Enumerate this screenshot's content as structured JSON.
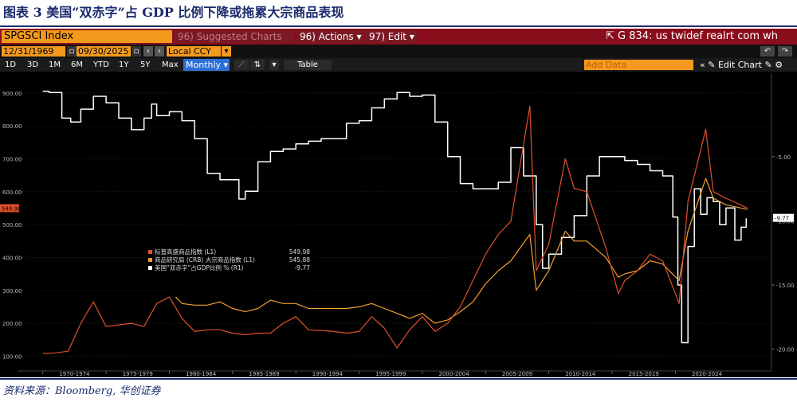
{
  "figure": {
    "title": "图表 3 美国“双赤字”占 GDP 比例下降或拖累大宗商品表现",
    "source": "资料来源：Bloomberg, 华创证券"
  },
  "terminal": {
    "ticker": "SPGSCI Index",
    "suggested": "96) Suggested Charts",
    "actions": "96) Actions",
    "edit": "97) Edit",
    "command": "G 834: us twidef realrt com wh",
    "start_date": "12/31/1969",
    "end_date": "09/30/2025",
    "currency": "Local CCY",
    "ranges": [
      "1D",
      "3D",
      "1M",
      "6M",
      "YTD",
      "1Y",
      "5Y",
      "Max"
    ],
    "frequency": "Monthly",
    "table_label": "Table",
    "add_data_placeholder": "Add Data",
    "edit_chart_label": "Edit Chart",
    "colors": {
      "bar_red": "#8a0d1c",
      "amber": "#f39a1e",
      "bg": "#000000"
    }
  },
  "chart_data": {
    "type": "line",
    "left_axis": {
      "ticks": [
        "100.00",
        "200.00",
        "300.00",
        "400.00",
        "500.00",
        "600.00",
        "700.00",
        "800.00",
        "900.00"
      ],
      "ylim": [
        55,
        960
      ]
    },
    "right_axis": {
      "ticks": [
        "-5.00",
        "-10.00",
        "-15.00",
        "-20.00"
      ],
      "ylim": [
        -21.7,
        1.5
      ]
    },
    "x_ticks": [
      "1970-1974",
      "1975-1979",
      "1980-1984",
      "1985-1989",
      "1990-1994",
      "1995-1999",
      "2000-2004",
      "2005-2009",
      "2010-2014",
      "2015-2019",
      "2020-2024"
    ],
    "xlim": [
      1968.0,
      2027.6
    ],
    "price_tag": "549.98",
    "deficit_tag": "-9.77",
    "legend": [
      {
        "name": "标普高盛商品指数 (L1)",
        "value": "549.98",
        "color": "#e0502b"
      },
      {
        "name": "商品研究局 (CRB) 大宗商品指数 (L1)",
        "value": "545.88",
        "color": "#f0a030"
      },
      {
        "name": "美国“双赤字”占GDP比例 % (R1)",
        "value": "-9.77",
        "color": "#ffffff"
      }
    ],
    "series": [
      {
        "name": "标普高盛商品指数 (L1)",
        "axis": "left",
        "x": [
          1970.0,
          1971.0,
          1972.0,
          1973.0,
          1974.0,
          1975.0,
          1976.0,
          1977.0,
          1978.0,
          1979.0,
          1980.0,
          1981.0,
          1982.0,
          1983.0,
          1984.0,
          1985.0,
          1986.0,
          1987.0,
          1988.0,
          1989.0,
          1990.0,
          1991.0,
          1992.0,
          1993.0,
          1994.0,
          1995.0,
          1996.0,
          1997.0,
          1998.0,
          1999.0,
          2000.0,
          2001.0,
          2002.0,
          2003.0,
          2004.0,
          2005.0,
          2006.0,
          2007.0,
          2008.5,
          2009.0,
          2010.0,
          2011.3,
          2012.0,
          2013.0,
          2014.5,
          2015.5,
          2016.0,
          2017.0,
          2018.0,
          2019.0,
          2020.3,
          2021.0,
          2022.4,
          2023.0,
          2024.0,
          2025.7
        ],
        "y": [
          108,
          110,
          115,
          200,
          265,
          190,
          195,
          200,
          190,
          260,
          280,
          215,
          175,
          180,
          180,
          170,
          165,
          170,
          170,
          200,
          220,
          180,
          178,
          175,
          170,
          175,
          220,
          185,
          125,
          180,
          220,
          175,
          200,
          250,
          330,
          410,
          470,
          510,
          860,
          360,
          440,
          700,
          610,
          600,
          430,
          290,
          330,
          360,
          410,
          390,
          260,
          570,
          790,
          600,
          580,
          550
        ]
      },
      {
        "name": "商品研究局 (CRB) 大宗商品指数 (L1)",
        "axis": "left",
        "x": [
          1980.5,
          1981.0,
          1982.0,
          1983.0,
          1984.0,
          1985.0,
          1986.0,
          1987.0,
          1988.0,
          1989.0,
          1990.0,
          1991.0,
          1992.0,
          1993.0,
          1994.0,
          1995.0,
          1996.0,
          1997.0,
          1998.0,
          1999.0,
          2000.0,
          2001.0,
          2002.0,
          2003.0,
          2004.0,
          2005.0,
          2006.0,
          2007.0,
          2008.5,
          2009.0,
          2010.0,
          2011.3,
          2012.0,
          2013.0,
          2014.5,
          2015.5,
          2016.0,
          2017.0,
          2018.0,
          2019.0,
          2020.3,
          2021.0,
          2022.4,
          2023.0,
          2024.0,
          2025.7
        ],
        "y": [
          280,
          260,
          255,
          255,
          265,
          245,
          235,
          245,
          270,
          260,
          260,
          245,
          245,
          245,
          245,
          250,
          260,
          245,
          230,
          215,
          230,
          200,
          210,
          235,
          265,
          320,
          360,
          390,
          470,
          300,
          360,
          480,
          450,
          450,
          400,
          340,
          350,
          360,
          390,
          380,
          330,
          480,
          640,
          580,
          560,
          546
        ]
      },
      {
        "name": "美国“双赤字”占GDP比例 % (R1)",
        "axis": "right",
        "x": [
          1970.0,
          1970.5,
          1971.5,
          1972.2,
          1973.0,
          1974.0,
          1975.0,
          1976.0,
          1977.0,
          1978.0,
          1978.6,
          1979.0,
          1980.0,
          1981.0,
          1982.0,
          1983.0,
          1984.0,
          1985.5,
          1986.0,
          1987.0,
          1988.0,
          1989.0,
          1990.0,
          1991.0,
          1992.0,
          1993.0,
          1994.0,
          1995.0,
          1996.0,
          1997.0,
          1998.0,
          1999.0,
          2000.0,
          2001.0,
          2002.0,
          2003.0,
          2004.0,
          2005.0,
          2006.0,
          2007.0,
          2008.0,
          2009.0,
          2009.5,
          2010.0,
          2011.0,
          2012.0,
          2013.0,
          2014.0,
          2015.0,
          2016.0,
          2017.0,
          2018.0,
          2019.0,
          2019.8,
          2020.2,
          2020.5,
          2021.0,
          2021.5,
          2022.0,
          2022.5,
          2023.0,
          2023.5,
          2024.0,
          2024.7,
          2025.2,
          2025.6
        ],
        "y": [
          0.1,
          0.0,
          -2.0,
          -2.3,
          -1.3,
          -0.3,
          -0.8,
          -2.0,
          -2.9,
          -2.0,
          -0.9,
          -1.8,
          -1.5,
          -2.2,
          -3.6,
          -6.3,
          -6.8,
          -8.3,
          -7.7,
          -5.4,
          -4.6,
          -4.4,
          -4.0,
          -3.8,
          -3.6,
          -3.6,
          -2.4,
          -2.2,
          -1.2,
          -0.5,
          0.0,
          -0.3,
          -0.2,
          -2.3,
          -5.0,
          -7.1,
          -7.5,
          -7.5,
          -7.0,
          -4.3,
          -6.5,
          -10.3,
          -13.7,
          -12.6,
          -11.3,
          -9.6,
          -6.5,
          -5.0,
          -5.0,
          -5.3,
          -5.6,
          -6.1,
          -6.5,
          -9.7,
          -15.0,
          -19.5,
          -12.0,
          -7.5,
          -9.5,
          -8.2,
          -8.5,
          -10.3,
          -9.0,
          -11.5,
          -10.5,
          -9.8
        ]
      }
    ]
  }
}
